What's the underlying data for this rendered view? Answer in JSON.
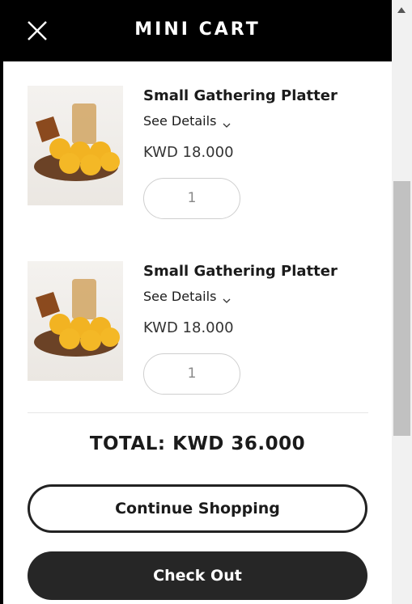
{
  "header": {
    "title": "MINI CART",
    "close_icon": "close-icon"
  },
  "items": [
    {
      "name": "Small Gathering Platter",
      "details_label": "See Details",
      "price": "KWD 18.000",
      "quantity": "1",
      "image": "platter-image"
    },
    {
      "name": "Small Gathering Platter",
      "details_label": "See Details",
      "price": "KWD 18.000",
      "quantity": "1",
      "image": "platter-image"
    }
  ],
  "total": "TOTAL: KWD 36.000",
  "buttons": {
    "continue": "Continue Shopping",
    "checkout": "Check Out"
  },
  "colors": {
    "header_bg": "#000000",
    "checkout_bg": "#262626",
    "text": "#1b1b1b"
  }
}
